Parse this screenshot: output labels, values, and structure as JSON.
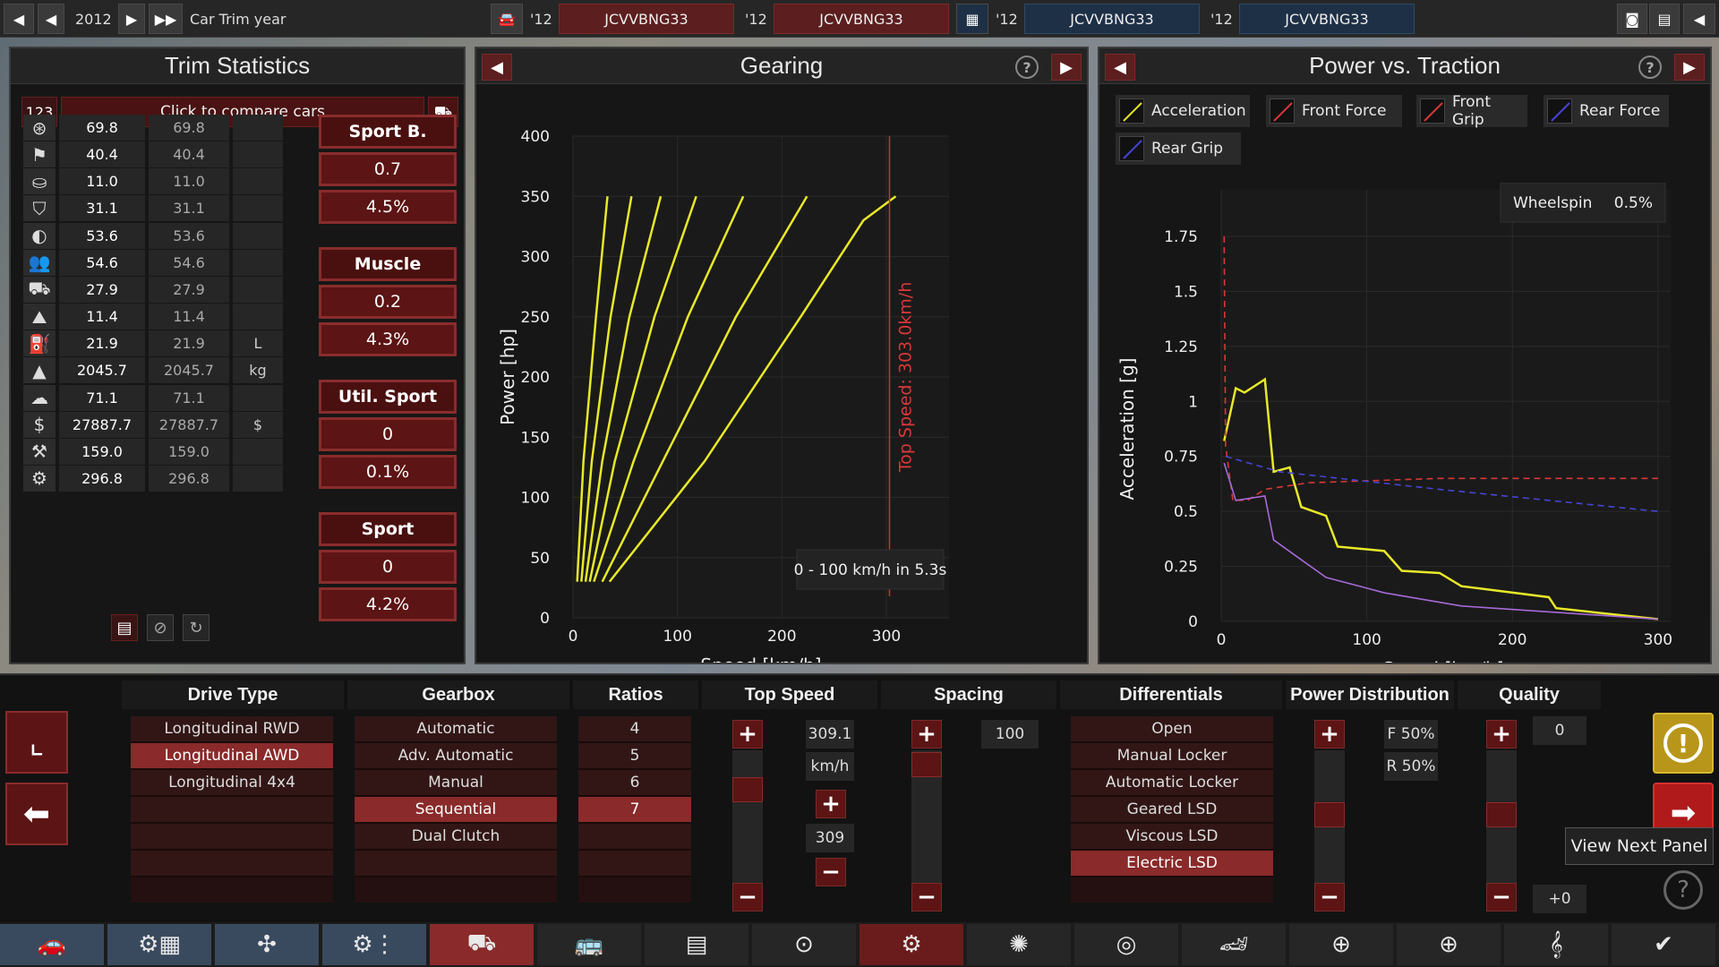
{
  "topbar": {
    "year": "2012",
    "mode_label": "Car Trim year",
    "cars": [
      {
        "year": "'12",
        "name": "JCVVBNG33"
      },
      {
        "year": "'12",
        "name": "JCVVBNG33"
      },
      {
        "year": "'12",
        "name": "JCVVBNG33"
      },
      {
        "year": "'12",
        "name": "JCVVBNG33"
      }
    ],
    "icons": [
      "rewind-icon",
      "prev-icon",
      "play-icon",
      "fast-forward-icon",
      "car-icon",
      "grid-icon",
      "camera-icon",
      "calculator-icon",
      "back-arrow-icon"
    ]
  },
  "trim_stats": {
    "title": "Trim Statistics",
    "compare_number": "123",
    "compare_label": "Click to compare cars",
    "rows": [
      {
        "icon": "steering-wheel-icon",
        "v1": "69.8",
        "v2": "69.8",
        "unit": ""
      },
      {
        "icon": "race-flag-icon",
        "v1": "40.4",
        "v2": "40.4",
        "unit": ""
      },
      {
        "icon": "seat-icon",
        "v1": "11.0",
        "v2": "11.0",
        "unit": ""
      },
      {
        "icon": "shield-icon",
        "v1": "31.1",
        "v2": "31.1",
        "unit": ""
      },
      {
        "icon": "safety-icon",
        "v1": "53.6",
        "v2": "53.6",
        "unit": ""
      },
      {
        "icon": "passengers-icon",
        "v1": "54.6",
        "v2": "54.6",
        "unit": ""
      },
      {
        "icon": "cargo-car-icon",
        "v1": "27.9",
        "v2": "27.9",
        "unit": ""
      },
      {
        "icon": "offroad-icon",
        "v1": "11.4",
        "v2": "11.4",
        "unit": ""
      },
      {
        "icon": "fuel-icon",
        "v1": "21.9",
        "v2": "21.9",
        "unit": "L"
      },
      {
        "icon": "weight-icon",
        "v1": "2045.7",
        "v2": "2045.7",
        "unit": "kg"
      },
      {
        "icon": "emissions-icon",
        "v1": "71.1",
        "v2": "71.1",
        "unit": ""
      },
      {
        "icon": "cost-icon",
        "v1": "27887.7",
        "v2": "27887.7",
        "unit": "$"
      },
      {
        "icon": "service-icon",
        "v1": "159.0",
        "v2": "159.0",
        "unit": ""
      },
      {
        "icon": "engineering-icon",
        "v1": "296.8",
        "v2": "296.8",
        "unit": ""
      }
    ],
    "categories": [
      {
        "name": "Sport B.",
        "score": "0.7",
        "pct": "4.5%"
      },
      {
        "name": "Muscle",
        "score": "0.2",
        "pct": "4.3%"
      },
      {
        "name": "Util. Sport",
        "score": "0",
        "pct": "0.1%"
      },
      {
        "name": "Sport",
        "score": "0",
        "pct": "4.2%"
      }
    ]
  },
  "gearing": {
    "title": "Gearing",
    "accel_note": "0 - 100 km/h in 5.3s",
    "top_speed_label": "Top Speed: 303.0km/h"
  },
  "power_traction": {
    "title": "Power vs. Traction",
    "legend": [
      "Acceleration",
      "Front Force",
      "Front Grip",
      "Rear Force",
      "Rear Grip"
    ],
    "wheelspin_label": "Wheelspin",
    "wheelspin_value": "0.5%"
  },
  "chart_data": [
    {
      "type": "line",
      "title": "Gearing",
      "xlabel": "Speed [km/h]",
      "ylabel": "Power [hp]",
      "xlim": [
        0,
        360
      ],
      "ylim": [
        0,
        400
      ],
      "xticks": [
        0,
        100,
        200,
        300
      ],
      "yticks": [
        0,
        50,
        100,
        150,
        200,
        250,
        300,
        350,
        400
      ],
      "series": [
        {
          "values": [
            [
              4,
              30
            ],
            [
              10,
              130
            ],
            [
              22,
              250
            ],
            [
              33,
              350
            ]
          ]
        },
        {
          "values": [
            [
              8,
              30
            ],
            [
              18,
              130
            ],
            [
              36,
              250
            ],
            [
              56,
              350
            ]
          ]
        },
        {
          "values": [
            [
              12,
              30
            ],
            [
              28,
              130
            ],
            [
              54,
              250
            ],
            [
              84,
              350
            ]
          ]
        },
        {
          "values": [
            [
              16,
              30
            ],
            [
              40,
              130
            ],
            [
              78,
              250
            ],
            [
              118,
              350
            ]
          ]
        },
        {
          "values": [
            [
              20,
              30
            ],
            [
              58,
              130
            ],
            [
              110,
              250
            ],
            [
              163,
              350
            ]
          ]
        },
        {
          "values": [
            [
              28,
              30
            ],
            [
              86,
              130
            ],
            [
              156,
              250
            ],
            [
              224,
              350
            ]
          ]
        },
        {
          "values": [
            [
              35,
              30
            ],
            [
              126,
              130
            ],
            [
              218,
              250
            ],
            [
              278,
              330
            ],
            [
              309,
              350
            ]
          ]
        }
      ],
      "vline": {
        "x": 303
      }
    },
    {
      "type": "line",
      "title": "Power vs. Traction",
      "xlabel": "Speed [km/h]",
      "ylabel": "Acceleration [g]",
      "xlim": [
        0,
        305
      ],
      "ylim": [
        0,
        1.75
      ],
      "xticks": [
        0,
        100,
        200,
        300
      ],
      "yticks": [
        0,
        0.25,
        0.5,
        0.75,
        1,
        1.25,
        1.5,
        1.75
      ],
      "series": [
        {
          "name": "Acceleration",
          "color": "#e8e82a",
          "values": [
            [
              2,
              0.82
            ],
            [
              10,
              1.06
            ],
            [
              16,
              1.04
            ],
            [
              30,
              1.1
            ],
            [
              36,
              0.68
            ],
            [
              47,
              0.7
            ],
            [
              55,
              0.52
            ],
            [
              72,
              0.48
            ],
            [
              80,
              0.34
            ],
            [
              112,
              0.32
            ],
            [
              124,
              0.23
            ],
            [
              150,
              0.22
            ],
            [
              165,
              0.16
            ],
            [
              225,
              0.11
            ],
            [
              230,
              0.06
            ],
            [
              300,
              0.01
            ]
          ]
        },
        {
          "name": "Front Force",
          "color": "#d83838",
          "values": [
            [
              2,
              1.75
            ],
            [
              3,
              0.8
            ],
            [
              8,
              0.55
            ],
            [
              18,
              0.55
            ],
            [
              30,
              0.6
            ],
            [
              60,
              0.63
            ],
            [
              150,
              0.65
            ],
            [
              300,
              0.65
            ]
          ]
        },
        {
          "name": "Rear Force",
          "color": "#4545d8",
          "values": [
            [
              3,
              0.75
            ],
            [
              40,
              0.68
            ],
            [
              150,
              0.6
            ],
            [
              300,
              0.5
            ]
          ]
        },
        {
          "name": "Rear Grip",
          "color": "#a66ad8",
          "values": [
            [
              2,
              0.72
            ],
            [
              10,
              0.55
            ],
            [
              30,
              0.57
            ],
            [
              36,
              0.37
            ],
            [
              55,
              0.28
            ],
            [
              72,
              0.2
            ],
            [
              112,
              0.13
            ],
            [
              165,
              0.07
            ],
            [
              300,
              0.01
            ]
          ]
        }
      ]
    }
  ],
  "controls": {
    "drive_type": {
      "label": "Drive Type",
      "options": [
        "Longitudinal RWD",
        "Longitudinal AWD",
        "Longitudinal 4x4"
      ],
      "selected": 1
    },
    "gearbox": {
      "label": "Gearbox",
      "options": [
        "Automatic",
        "Adv. Automatic",
        "Manual",
        "Sequential",
        "Dual Clutch"
      ],
      "selected": 3
    },
    "ratios": {
      "label": "Ratios",
      "options": [
        "4",
        "5",
        "6",
        "7"
      ],
      "selected": 3
    },
    "top_speed": {
      "label": "Top Speed",
      "value": "309.1",
      "unit": "km/h",
      "target": "309"
    },
    "spacing": {
      "label": "Spacing",
      "value": "100"
    },
    "differentials": {
      "label": "Differentials",
      "options": [
        "Open",
        "Manual Locker",
        "Automatic Locker",
        "Geared LSD",
        "Viscous LSD",
        "Electric LSD"
      ],
      "selected": 5
    },
    "power_distribution": {
      "label": "Power Distribution",
      "front": "F 50%",
      "rear": "R 50%"
    },
    "quality": {
      "label": "Quality",
      "value": "0",
      "delta": "+0"
    },
    "next_panel_label": "View Next Panel"
  },
  "bottom_tabs": [
    "car-body-icon",
    "engine-parts-icon",
    "chassis-icon",
    "suspension-icon",
    "drivetrain-icon",
    "interior-icon",
    "fixtures-icon",
    "brakes-icon",
    "gearing-icon",
    "wheels-icon",
    "tyre-icon",
    "aero-icon",
    "steering-icon",
    "safety-icon",
    "test-icon",
    "finish-check-icon"
  ]
}
